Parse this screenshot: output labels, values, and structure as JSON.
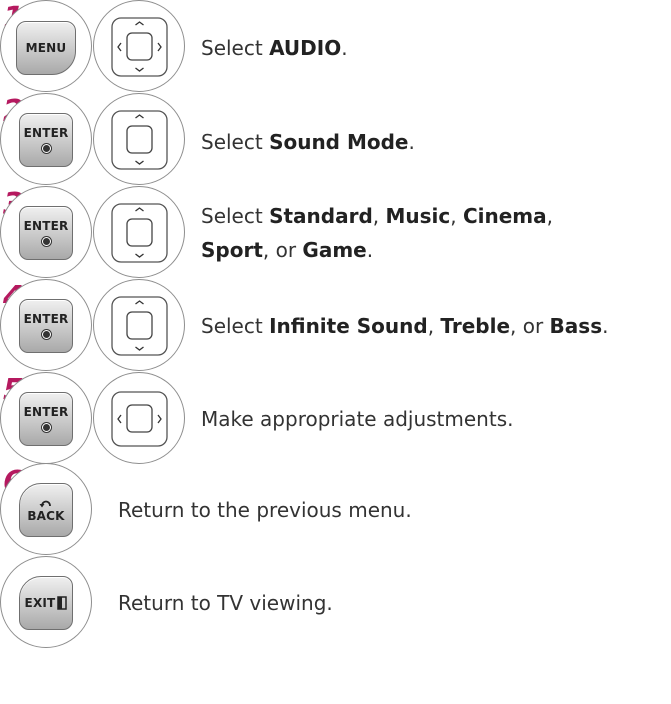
{
  "steps": [
    {
      "num": "1",
      "key": "MENU",
      "dpad": "4way",
      "parts": [
        {
          "t": "Select "
        },
        {
          "b": "AUDIO"
        },
        {
          "t": "."
        }
      ]
    },
    {
      "num": "2",
      "key": "ENTER",
      "dpad": "updown",
      "parts": [
        {
          "t": "Select "
        },
        {
          "b": "Sound Mode"
        },
        {
          "t": "."
        }
      ]
    },
    {
      "num": "3",
      "key": "ENTER",
      "dpad": "updown",
      "parts": [
        {
          "t": "Select "
        },
        {
          "b": "Standard"
        },
        {
          "t": ", "
        },
        {
          "b": "Music"
        },
        {
          "t": ", "
        },
        {
          "b": "Cinema"
        },
        {
          "t": ","
        }
      ],
      "parts2": [
        {
          "b": "Sport"
        },
        {
          "t": ", or "
        },
        {
          "b": "Game"
        },
        {
          "t": "."
        }
      ]
    },
    {
      "num": "4",
      "key": "ENTER",
      "dpad": "updown",
      "parts": [
        {
          "t": "Select "
        },
        {
          "b": "Infinite Sound"
        },
        {
          "t": ", "
        },
        {
          "b": "Treble"
        },
        {
          "t": ", or "
        },
        {
          "b": "Bass"
        },
        {
          "t": "."
        }
      ]
    },
    {
      "num": "5",
      "key": "ENTER",
      "dpad": "leftright",
      "parts": [
        {
          "t": "Make appropriate adjustments."
        }
      ]
    },
    {
      "num": "6",
      "key": "BACK",
      "dpad": "none",
      "parts": [
        {
          "t": "Return to the previous menu."
        }
      ]
    },
    {
      "num": "",
      "key": "EXIT",
      "dpad": "none",
      "parts": [
        {
          "t": "Return to TV viewing."
        }
      ]
    }
  ],
  "colors": {
    "step_number": "#b5195f"
  }
}
